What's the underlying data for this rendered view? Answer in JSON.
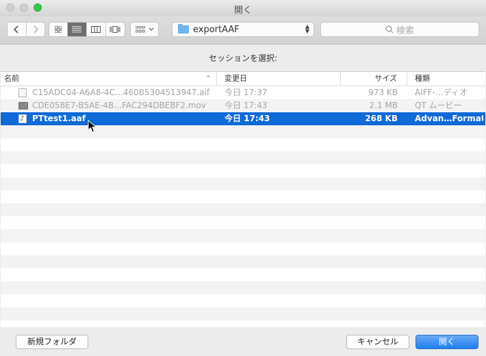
{
  "window": {
    "title": "開く"
  },
  "toolbar": {
    "location": "exportAAF",
    "search_placeholder": "検索"
  },
  "prompt": "セッションを選択:",
  "columns": {
    "name": "名前",
    "date": "変更日",
    "size": "サイズ",
    "kind": "種類"
  },
  "files": [
    {
      "name": "C15ADC04-A6A8-4C…460B5304513947.aif",
      "date": "今日 17:37",
      "size": "973 KB",
      "kind": "AIFF-…ディオ",
      "icon": "audio-file-icon",
      "state": "disabled"
    },
    {
      "name": "CDE058E7-B5AE-4B…FAC294DBEBF2.mov",
      "date": "今日 17:43",
      "size": "2.1 MB",
      "kind": "QT ムービー",
      "icon": "movie-file-icon",
      "state": "disabled"
    },
    {
      "name": "PTtest1.aaf",
      "date": "今日 17:43",
      "size": "268 KB",
      "kind": "Advan…Format",
      "icon": "aaf-file-icon",
      "state": "selected"
    }
  ],
  "buttons": {
    "new_folder": "新規フォルダ",
    "cancel": "キャンセル",
    "open": "開く"
  },
  "colors": {
    "selection": "#0f69d8",
    "primary_button": "#1f7ef0",
    "folder": "#6fb4ec"
  }
}
